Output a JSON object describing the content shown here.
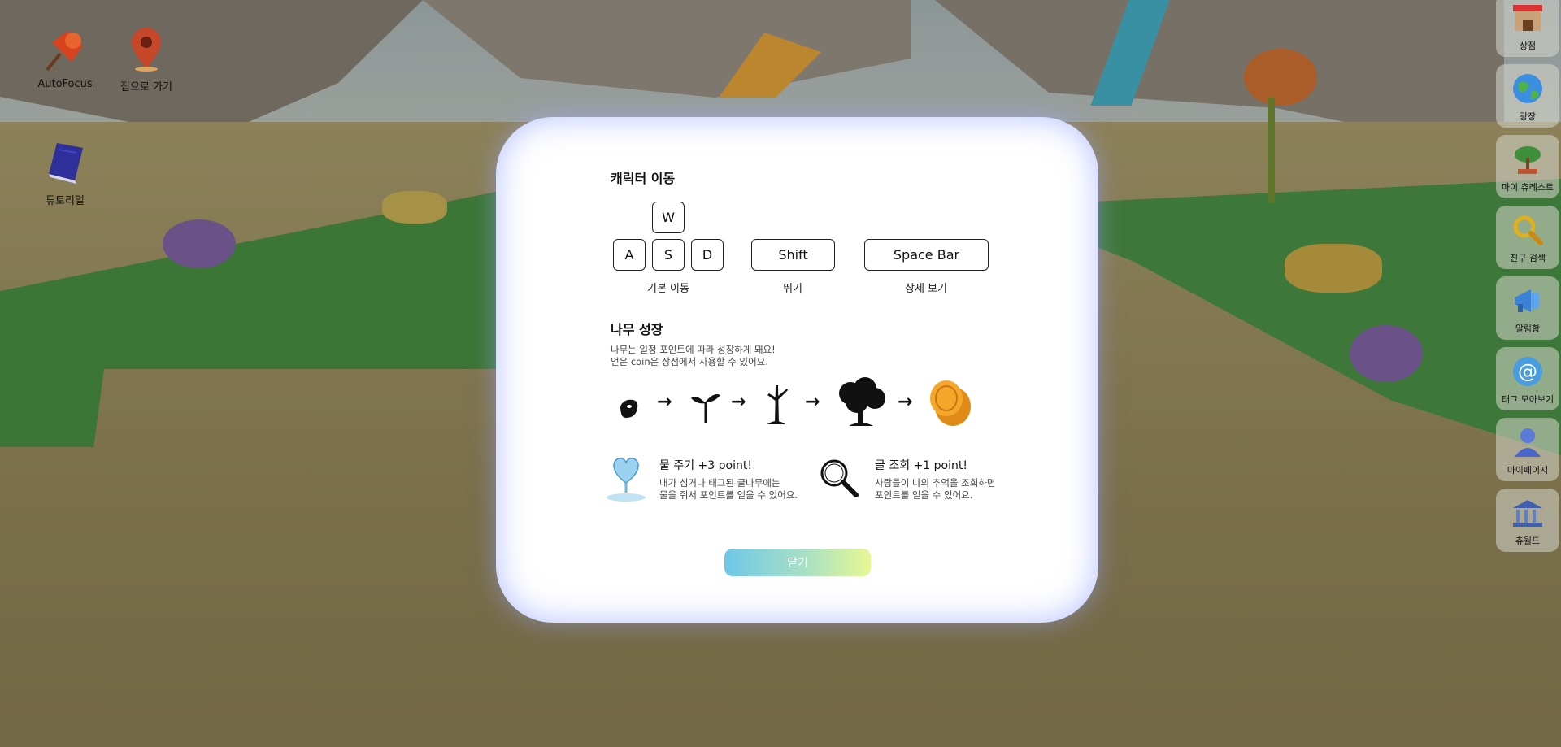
{
  "desktop": {
    "autofocus_label": "AutoFocus",
    "go_home_label": "집으로 가기",
    "tutorial_label": "튜토리얼"
  },
  "sidebar": {
    "items": [
      {
        "label": "상점",
        "icon": "shop-icon"
      },
      {
        "label": "광장",
        "icon": "globe-icon"
      },
      {
        "label": "마이 츄레스트",
        "icon": "bonsai-tree-icon"
      },
      {
        "label": "친구 검색",
        "icon": "magnifier-icon"
      },
      {
        "label": "알림함",
        "icon": "megaphone-icon"
      },
      {
        "label": "태그 모아보기",
        "icon": "at-sign-icon"
      },
      {
        "label": "마이페이지",
        "icon": "user-icon"
      },
      {
        "label": "츄월드",
        "icon": "museum-icon"
      }
    ]
  },
  "modal": {
    "movement_title": "캐릭터 이동",
    "keys": {
      "w": "W",
      "a": "A",
      "s": "S",
      "d": "D",
      "shift": "Shift",
      "space": "Space Bar"
    },
    "basic_move_label": "기본 이동",
    "jump_label": "뛰기",
    "detail_view_label": "상세 보기",
    "growth_title": "나무 성장",
    "growth_desc_1": "나무는 일정 포인트에 따라 성장하게 돼요!",
    "growth_desc_2": "얻은 coin은 상점에서 사용할 수 있어요.",
    "growth_stages": [
      "seed-icon",
      "sprout-icon",
      "sapling-icon",
      "tree-icon",
      "coin-icon"
    ],
    "water_title": "물 주기 +3 point!",
    "water_desc_1": "내가 심거나 태그된 글나무에는",
    "water_desc_2": "물을 줘서 포인트를 얻을 수 있어요.",
    "view_title": "글 조회 +1 point!",
    "view_desc_1": "사람들이 나의 추억을 조회하면",
    "view_desc_2": "포인트를 얻을 수 있어요.",
    "close_label": "닫기"
  },
  "colors": {
    "modal_glow": "#7c8cff",
    "close_gradient_start": "#6ec7e8",
    "close_gradient_end": "#e6f792",
    "grass": "#3d8b3d",
    "ground": "#a79a6a"
  }
}
